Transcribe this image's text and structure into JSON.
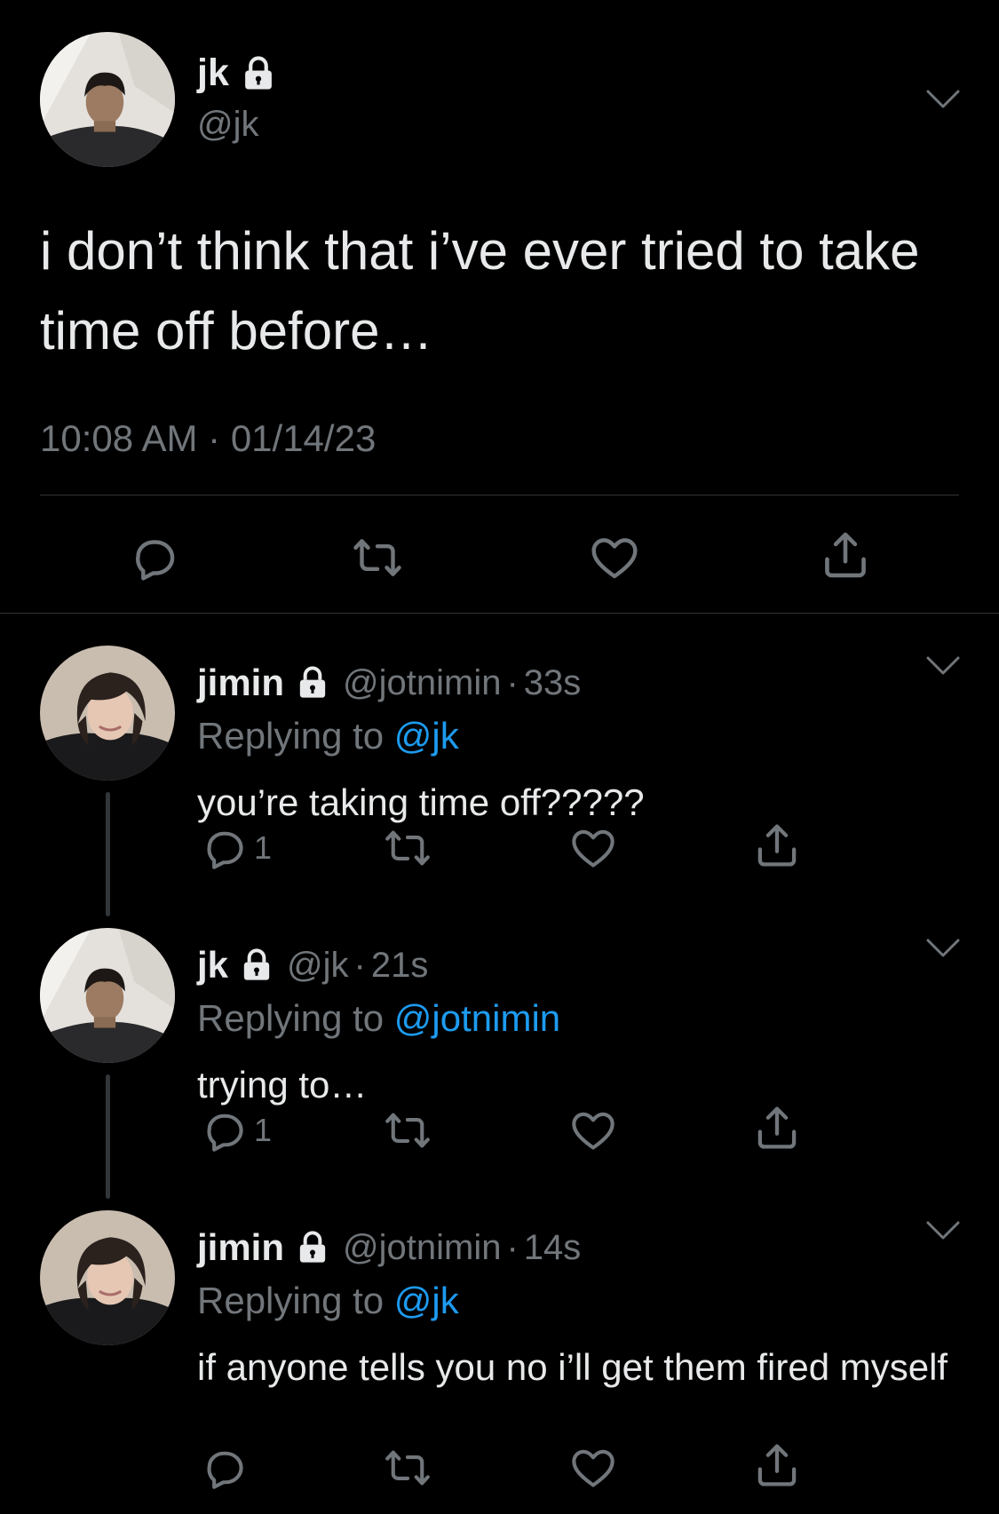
{
  "main_tweet": {
    "author_name": "jk",
    "author_handle": "@jk",
    "text": "i don’t think that i’ve ever tried to take time off before…",
    "time": "10:08 AM",
    "separator": "·",
    "date": "01/14/23",
    "icons": {
      "lock": "lock-icon",
      "more": "chevron-down-icon",
      "reply": "reply-icon",
      "retweet": "retweet-icon",
      "like": "heart-icon",
      "share": "share-icon"
    }
  },
  "replies": [
    {
      "author_name": "jimin",
      "author_handle": "@jotnimin",
      "separator": "·",
      "time": "33s",
      "replying_prefix": "Replying to ",
      "replying_to": "@jk",
      "text": "you’re taking time off?????",
      "reply_count": "1"
    },
    {
      "author_name": "jk",
      "author_handle": "@jk",
      "separator": "·",
      "time": "21s",
      "replying_prefix": "Replying to ",
      "replying_to": "@jotnimin",
      "text": "trying to…",
      "reply_count": "1"
    },
    {
      "author_name": "jimin",
      "author_handle": "@jotnimin",
      "separator": "·",
      "time": "14s",
      "replying_prefix": "Replying to ",
      "replying_to": "@jk",
      "text": "if anyone tells you no i’ll get them fired myself",
      "reply_count": ""
    }
  ],
  "colors": {
    "background": "#000000",
    "primary_text": "#e7e9ea",
    "secondary_text": "#71767b",
    "link": "#1d9bf0",
    "divider": "#2f3336"
  }
}
